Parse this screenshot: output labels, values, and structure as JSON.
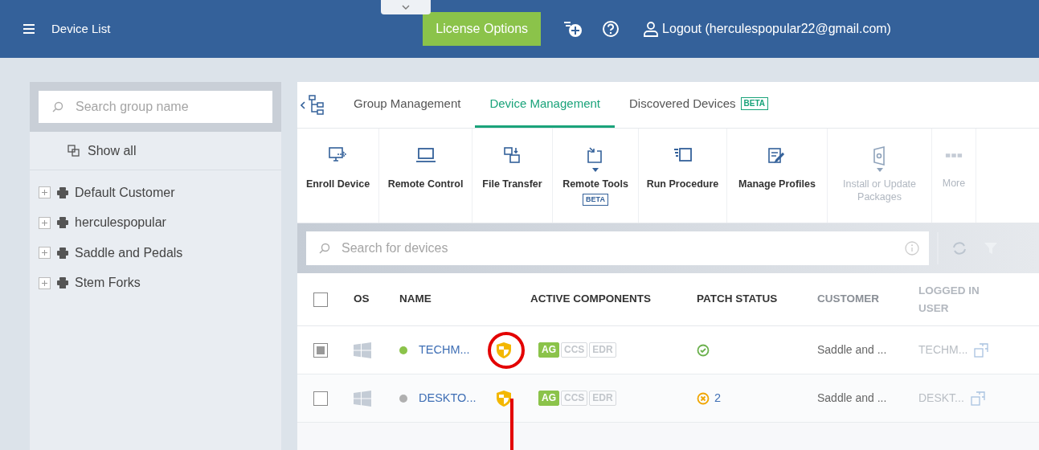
{
  "header": {
    "title": "Device List",
    "license_button": "License Options",
    "logout": "Logout (herculespopular22@gmail.com)"
  },
  "sidebar": {
    "search": {
      "placeholder": "Search group name"
    },
    "show_all": "Show all",
    "groups": [
      {
        "label": "Default Customer",
        "expanded": false
      },
      {
        "label": "herculespopular",
        "expanded": false
      },
      {
        "label": "Saddle and Pedals",
        "expanded": false
      },
      {
        "label": "Stem Forks",
        "expanded": false
      }
    ]
  },
  "tabs": [
    {
      "label": "Group Management",
      "selected": false
    },
    {
      "label": "Device Management",
      "selected": true
    },
    {
      "label": "Discovered Devices",
      "badge": "BETA",
      "selected": false
    }
  ],
  "toolbar": [
    {
      "kind": "enroll",
      "label": "Enroll Device",
      "disabled": false
    },
    {
      "kind": "remote",
      "label": "Remote Control",
      "disabled": false
    },
    {
      "kind": "file",
      "label": "File Transfer",
      "disabled": false
    },
    {
      "kind": "tools",
      "label": "Remote Tools",
      "badge": "BETA",
      "dropdown": true,
      "disabled": false
    },
    {
      "kind": "procedure",
      "label": "Run Procedure",
      "disabled": false
    },
    {
      "kind": "profiles",
      "label": "Manage Profiles",
      "disabled": false
    },
    {
      "kind": "install",
      "label": "Install or Update Packages",
      "dropdown": true,
      "disabled": true
    },
    {
      "kind": "more",
      "label": "More",
      "disabled": true
    }
  ],
  "device_search": {
    "placeholder": "Search for devices"
  },
  "table": {
    "select_all_checked": false,
    "columns": [
      "OS",
      "NAME",
      "ACTIVE COMPONENTS",
      "PATCH STATUS",
      "CUSTOMER",
      "LOGGED IN USER"
    ],
    "rows": [
      {
        "selected": true,
        "color": "#8bc34a",
        "name": "TECHM...",
        "components": [
          {
            "label": "AG",
            "active": true
          },
          {
            "label": "CCS",
            "active": false
          },
          {
            "label": "EDR",
            "active": false
          }
        ],
        "patch": {
          "kind": "ok"
        },
        "customer": "Saddle and ...",
        "user": "TECHM...",
        "highlighted": true
      },
      {
        "selected": false,
        "color": "#b0b0b0",
        "name": "DESKTO...",
        "components": [
          {
            "label": "AG",
            "active": true
          },
          {
            "label": "CCS",
            "active": false
          },
          {
            "label": "EDR",
            "active": false
          }
        ],
        "patch": {
          "kind": "missing",
          "count": "2"
        },
        "customer": "Saddle and ...",
        "user": "DESKT...",
        "highlighted": false
      }
    ]
  }
}
